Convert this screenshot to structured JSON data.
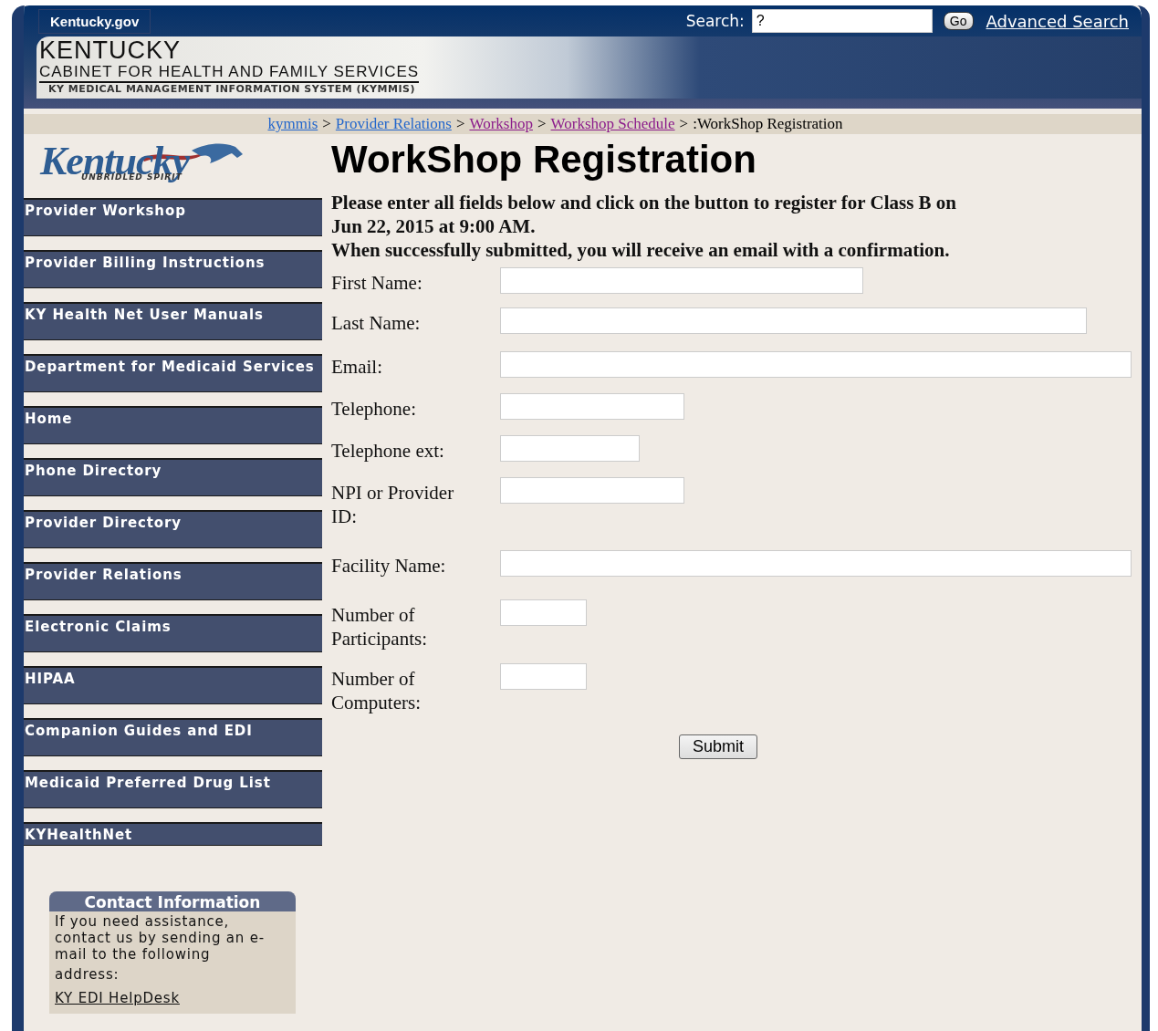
{
  "header": {
    "portal_link": "Kentucky.gov",
    "search_label": "Search:",
    "search_value": "?",
    "go_button": "Go",
    "advanced_search": "Advanced Search",
    "title": "KENTUCKY",
    "subtitle": "CABINET FOR HEALTH AND FAMILY SERVICES",
    "system": "KY MEDICAL MANAGEMENT INFORMATION SYSTEM (KYMMIS)"
  },
  "breadcrumb": {
    "links": [
      {
        "label": "kymmis",
        "visited": false
      },
      {
        "label": "Provider Relations",
        "visited": false
      },
      {
        "label": "Workshop",
        "visited": true
      },
      {
        "label": "Workshop Schedule",
        "visited": true
      }
    ],
    "separator": ">",
    "current": ":WorkShop Registration"
  },
  "sidebar": {
    "logo_text": "Kentucky",
    "logo_tagline": "UNBRIDLED SPIRIT",
    "items": [
      "Provider Workshop",
      "Provider Billing Instructions",
      "KY Health Net User Manuals",
      "Department for Medicaid Services",
      "Home",
      "Phone Directory",
      "Provider Directory",
      "Provider Relations",
      "Electronic Claims",
      "HIPAA",
      "Companion Guides and EDI",
      "Medicaid Preferred Drug List",
      "KYHealthNet"
    ],
    "contact": {
      "title": "Contact Information",
      "text": "If you need assistance, contact us by sending an e-mail to the following",
      "text_2": "address:",
      "link": "KY EDI HelpDesk"
    }
  },
  "main": {
    "title": "WorkShop Registration",
    "instructions": [
      "Please enter all fields below and click on the button to register for Class B on Jun 22, 2015 at 9:00 AM.",
      "When successfully submitted, you will receive an email with a confirmation."
    ],
    "fields": [
      {
        "label": "First Name:"
      },
      {
        "label": "Last Name:"
      },
      {
        "label": "Email:"
      },
      {
        "label": "Telephone:"
      },
      {
        "label": "Telephone ext:"
      },
      {
        "label": "NPI or Provider ID:"
      },
      {
        "label": "Facility Name:"
      },
      {
        "label": "Number of Participants:"
      },
      {
        "label": "Number of Computers:"
      }
    ],
    "submit": "Submit"
  }
}
